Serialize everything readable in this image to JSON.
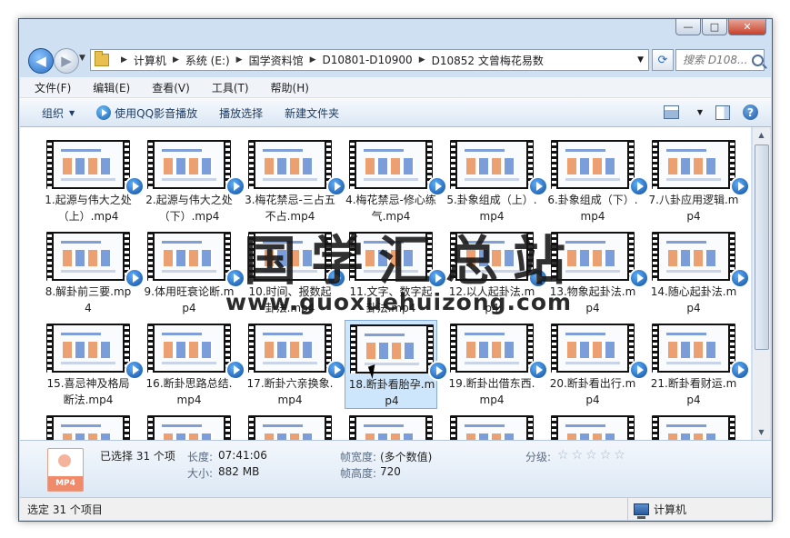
{
  "window": {
    "controls": {
      "minimize": "—",
      "maximize": "□",
      "close": "✕"
    }
  },
  "nav": {
    "back_icon": "back-arrow-icon",
    "forward_icon": "forward-arrow-icon",
    "breadcrumbs": [
      "计算机",
      "系统 (E:)",
      "国学资料馆",
      "D10801-D10900",
      "D10852 文曾梅花易数"
    ],
    "search_placeholder": "搜索 D108..."
  },
  "menu": [
    "文件(F)",
    "编辑(E)",
    "查看(V)",
    "工具(T)",
    "帮助(H)"
  ],
  "toolbar": {
    "organize": "组织",
    "qq_player": "使用QQ影音播放",
    "play_selection": "播放选择",
    "new_folder": "新建文件夹",
    "help": "?"
  },
  "files": [
    {
      "name": "1.起源与伟大之处（上）.mp4"
    },
    {
      "name": "2.起源与伟大之处（下）.mp4"
    },
    {
      "name": "3.梅花禁忌-三占五不占.mp4"
    },
    {
      "name": "4.梅花禁忌-修心练气.mp4"
    },
    {
      "name": "5.卦象组成（上）.mp4"
    },
    {
      "name": "6.卦象组成（下）.mp4"
    },
    {
      "name": "7.八卦应用逻辑.mp4"
    },
    {
      "name": "8.解卦前三要.mp4"
    },
    {
      "name": "9.体用旺衰论断.mp4"
    },
    {
      "name": "10.时间、报数起卦法.mp4"
    },
    {
      "name": "11.文字、数字起卦法.mp4"
    },
    {
      "name": "12.以人起卦法.mp4"
    },
    {
      "name": "13.物象起卦法.mp4"
    },
    {
      "name": "14.随心起卦法.mp4"
    },
    {
      "name": "15.喜忌神及格局断法.mp4"
    },
    {
      "name": "16.断卦思路总结.mp4"
    },
    {
      "name": "17.断卦六亲换象.mp4"
    },
    {
      "name": "18.断卦看胎孕.mp4",
      "selected": true
    },
    {
      "name": "19.断卦出借东西.mp4"
    },
    {
      "name": "20.断卦看出行.mp4"
    },
    {
      "name": "21.断卦看财运.mp4"
    },
    {
      "name": ""
    },
    {
      "name": ""
    },
    {
      "name": ""
    },
    {
      "name": ""
    },
    {
      "name": ""
    },
    {
      "name": ""
    },
    {
      "name": ""
    }
  ],
  "watermark": {
    "cn": "国学汇总站",
    "url": "www.guoxuehuizong.com"
  },
  "details": {
    "icon_label": "MP4",
    "selected": "已选择 31 个项",
    "length_label": "长度:",
    "length": "07:41:06",
    "size_label": "大小:",
    "size": "882 MB",
    "frame_width_label": "帧宽度:",
    "frame_width": "(多个数值)",
    "frame_height_label": "帧高度:",
    "frame_height": "720",
    "rating_label": "分级:"
  },
  "status": {
    "left": "选定 31 个项目",
    "right": "计算机"
  }
}
